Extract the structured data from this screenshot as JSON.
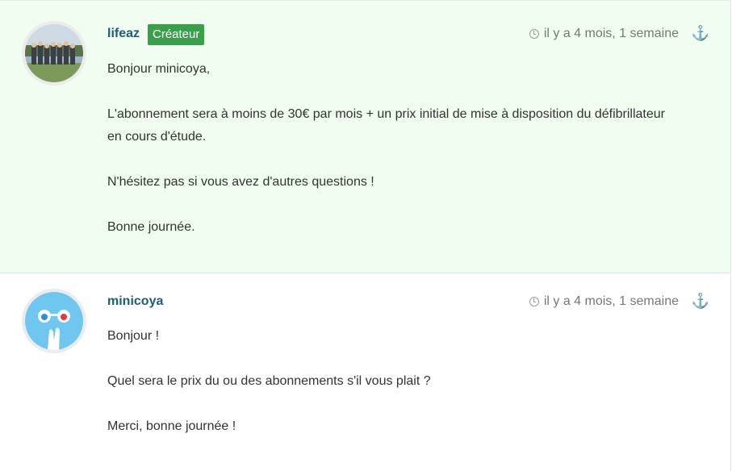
{
  "comments": [
    {
      "author": "lifeaz",
      "badge": "Créateur",
      "time": "il y a 4 mois, 1 semaine",
      "anchor_icon": "anchor-icon",
      "paragraphs": [
        "Bonjour minicoya,",
        "L'abonnement sera à moins de 30€ par mois + un prix initial de mise à disposition du défibrillateur en cours d'étude.",
        "N'hésitez pas si vous avez d'autres questions !",
        "Bonne journée."
      ]
    },
    {
      "author": "minicoya",
      "time": "il y a 4 mois, 1 semaine",
      "anchor_icon": "anchor-icon",
      "paragraphs": [
        "Bonjour !",
        "Quel sera le prix du ou des abonnements s'il vous plait ?",
        "Merci, bonne journée !"
      ]
    }
  ],
  "colors": {
    "creator_bg": "#f0fdf0",
    "author_link": "#1b5e7a",
    "badge_bg": "#3a9f4b"
  }
}
